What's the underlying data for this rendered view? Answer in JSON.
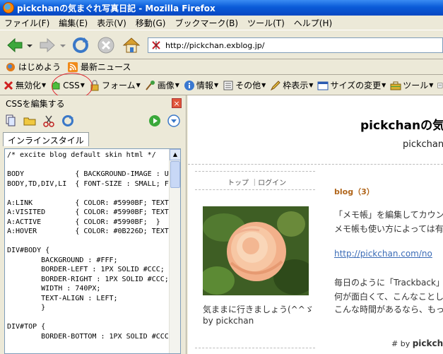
{
  "window": {
    "title": "pickchanの気まぐれ写真日記 - Mozilla Firefox"
  },
  "menu": [
    "ファイル(F)",
    "編集(E)",
    "表示(V)",
    "移動(G)",
    "ブックマーク(B)",
    "ツール(T)",
    "ヘルプ(H)"
  ],
  "nav": {
    "url": "http://pickchan.exblog.jp/"
  },
  "bookmarks": [
    "はじめよう",
    "最新ニュース"
  ],
  "devtools": {
    "items": [
      "無効化",
      "CSS",
      "フォーム",
      "画像",
      "情報",
      "その他",
      "枠表示",
      "サイズの変更",
      "ツール"
    ]
  },
  "css_panel": {
    "title": "CSSを編集する",
    "close": "×",
    "tab": "インラインスタイル",
    "code": "/* excite blog default skin html */\n\nBODY            { BACKGROUND-IMAGE : U\nBODY,TD,DIV,LI  { FONT-SIZE : SMALL; F\n\nA:LINK          { COLOR: #5990BF; TEXT\nA:VISITED       { COLOR: #5990BF; TEXT\nA:ACTIVE        { COLOR: #5990BF;  }\nA:HOVER         { COLOR: #0B226D; TEXT\n\nDIV#BODY {\n        BACKGROUND : #FFF;\n        BORDER-LEFT : 1PX SOLID #CCC;\n        BORDER-RIGHT : 1PX SOLID #CCC;\n        WIDTH : 740PX;\n        TEXT-ALIGN : LEFT;\n        }\n\nDIV#TOP {\n        BORDER-BOTTOM : 1PX SOLID #CCC"
  },
  "web": {
    "title": "pickchanの気",
    "subtitle": "pickchan",
    "top_links": "トップ ｜ログイン",
    "image_caption_1": "気ままに行きましょう(^^ゞ",
    "image_caption_2": "by pickchan",
    "category": "blog（3）",
    "p1": "「メモ帳」を編集してカウンタ",
    "p2": "メモ帳も使い方によっては有",
    "link": "http://pickchan.com/no",
    "p3": "毎日のように「Trackback」",
    "p4": "何が面白くて、こんなことして",
    "p5": "こんな時間があるなら、もっと",
    "byline_hash": "#",
    "byline_by": "by",
    "byline_name": "pickch"
  }
}
